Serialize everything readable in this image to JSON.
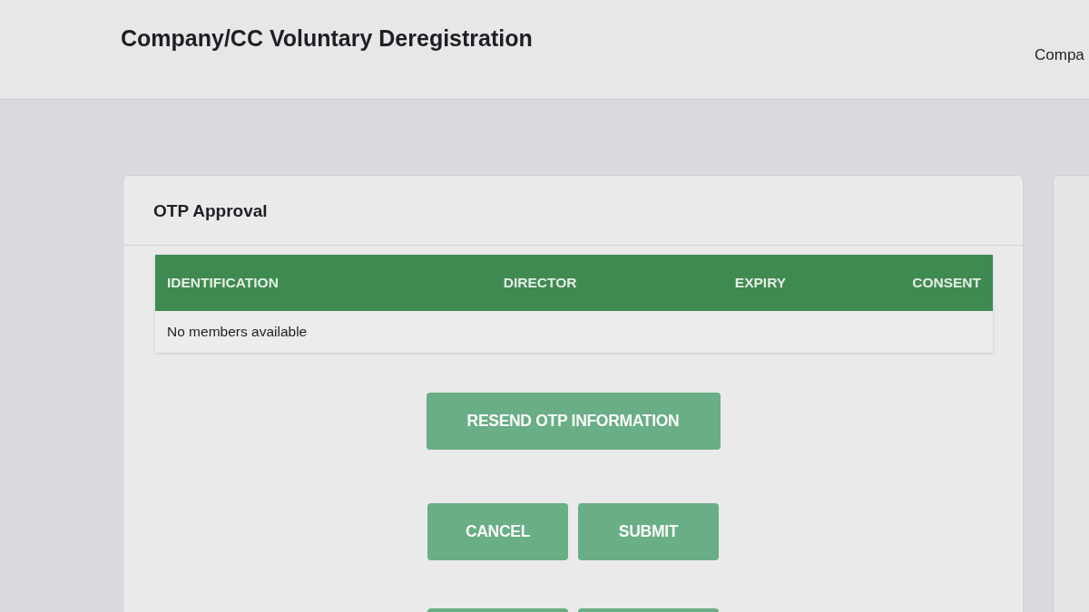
{
  "header": {
    "title": "Company/CC Voluntary Deregistration",
    "breadcrumb": "Compa"
  },
  "otp_card": {
    "title": "OTP Approval",
    "table": {
      "columns": [
        "IDENTIFICATION",
        "DIRECTOR",
        "EXPIRY",
        "CONSENT"
      ],
      "empty_message": "No members available"
    },
    "resend_button": {
      "label": "RESEND OTP INFORMATION",
      "disabled": true
    },
    "actions": [
      {
        "label": "CANCEL",
        "disabled": true
      },
      {
        "label": "SUBMIT",
        "disabled": true
      }
    ],
    "lower_actions": [
      {
        "disabled": true
      },
      {
        "disabled": true
      }
    ]
  }
}
